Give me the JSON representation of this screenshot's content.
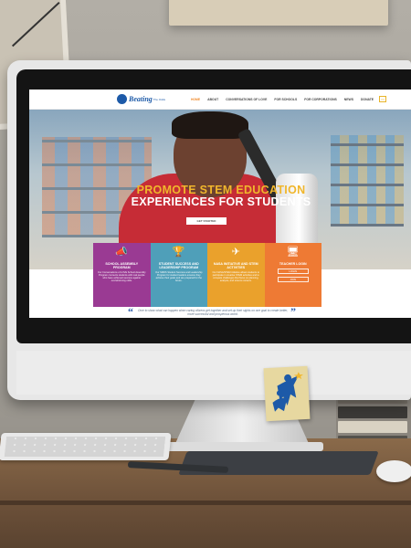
{
  "colors": {
    "brand_blue": "#1d5aa8",
    "accent_orange": "#f08a2c",
    "hero_yellow": "#f0b62c",
    "card_purple": "#9a3a93",
    "card_teal": "#4f9fb9",
    "card_gold": "#eaa12c",
    "card_orange": "#ee7a34"
  },
  "site": {
    "logo": {
      "name": "Beating",
      "sub": "The Odds"
    },
    "nav": [
      {
        "label": "HOME",
        "active": true
      },
      {
        "label": "ABOUT",
        "active": false
      },
      {
        "label": "CONVERSATIONS OF LOVE",
        "active": false
      },
      {
        "label": "FOR SCHOOLS",
        "active": false
      },
      {
        "label": "FOR CORPORATIONS",
        "active": false
      },
      {
        "label": "NEWS",
        "active": false
      },
      {
        "label": "DONATE",
        "active": false
      }
    ],
    "nav_icon": "cart-icon"
  },
  "hero": {
    "title_line1": "PROMOTE STEM EDUCATION",
    "title_line2": "EXPERIENCES FOR STUDENTS",
    "button": "GET STARTED"
  },
  "cards": [
    {
      "icon": "megaphone-icon",
      "glyph": "📣",
      "title": "SCHOOL ASSEMBLY PROGRAM",
      "text": "Our Conversations of LOVE School Assembly Program connects students with real people who have achieved success against overwhelming odds."
    },
    {
      "icon": "trophy-icon",
      "glyph": "🏆",
      "title": "STUDENT SUCCESS AND LEADERSHIP PROGRAM",
      "text": "Our SMDS Student Success and Leadership Program for student leaders ensures they achieve their goals and are prepared for the future."
    },
    {
      "icon": "paper-plane-icon",
      "glyph": "✈",
      "title": "NASA INITIATIVE AND STEM ACTIVITIES",
      "text": "Our NASA/STEM initiative allows students to participate in creative STEM activities and to compete challenges that focus on planning, analysis, and science careers."
    },
    {
      "icon": "login-screen-icon",
      "glyph": "🖥",
      "title": "TEACHER LOGIN",
      "text": "",
      "buttons": [
        "LOGIN",
        "JOIN"
      ]
    }
  ],
  "quote": {
    "text": "Over to show what can happen when caring citizens get together and set up their sights on one goal to create better, more successful and prosperous world."
  }
}
